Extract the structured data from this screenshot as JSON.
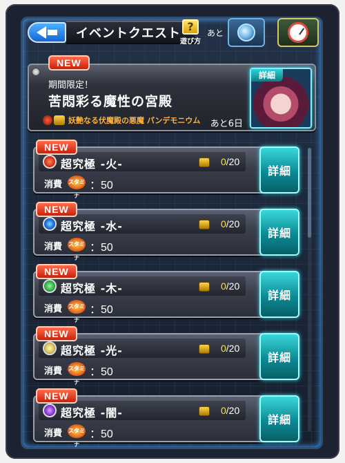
{
  "header": {
    "back_label": "",
    "title": "イベントクエスト",
    "help_icon": "?",
    "help_label": "遊び方",
    "remain_prefix": "あと"
  },
  "featured": {
    "badge": "NEW",
    "period": "期間限定！",
    "title": "苦悶彩る魔性の宮殿",
    "boss": "妖艶なる伏魔殿の悪魔 パンデモニウム",
    "days_left": "あと6日",
    "detail_label": "詳細"
  },
  "quests": [
    {
      "badge": "NEW",
      "name": "超究極 -火-",
      "element_color": "#e0361c",
      "progress": "0",
      "total": "/20",
      "cost_label": "消費",
      "stamina_label": "スタミナ",
      "cost": "：50",
      "detail": "詳細"
    },
    {
      "badge": "NEW",
      "name": "超究極 -水-",
      "element_color": "#1a6fe0",
      "progress": "0",
      "total": "/20",
      "cost_label": "消費",
      "stamina_label": "スタミナ",
      "cost": "：50",
      "detail": "詳細"
    },
    {
      "badge": "NEW",
      "name": "超究極 -木-",
      "element_color": "#2fb54a",
      "progress": "0",
      "total": "/20",
      "cost_label": "消費",
      "stamina_label": "スタミナ",
      "cost": "：50",
      "detail": "詳細"
    },
    {
      "badge": "NEW",
      "name": "超究極 -光-",
      "element_color": "#d8c25a",
      "progress": "0",
      "total": "/20",
      "cost_label": "消費",
      "stamina_label": "スタミナ",
      "cost": "：50",
      "detail": "詳細"
    },
    {
      "badge": "NEW",
      "name": "超究極 -闇-",
      "element_color": "#8a3ad8",
      "progress": "0",
      "total": "/20",
      "cost_label": "消費",
      "stamina_label": "スタミナ",
      "cost": "：50",
      "detail": "詳細"
    }
  ]
}
